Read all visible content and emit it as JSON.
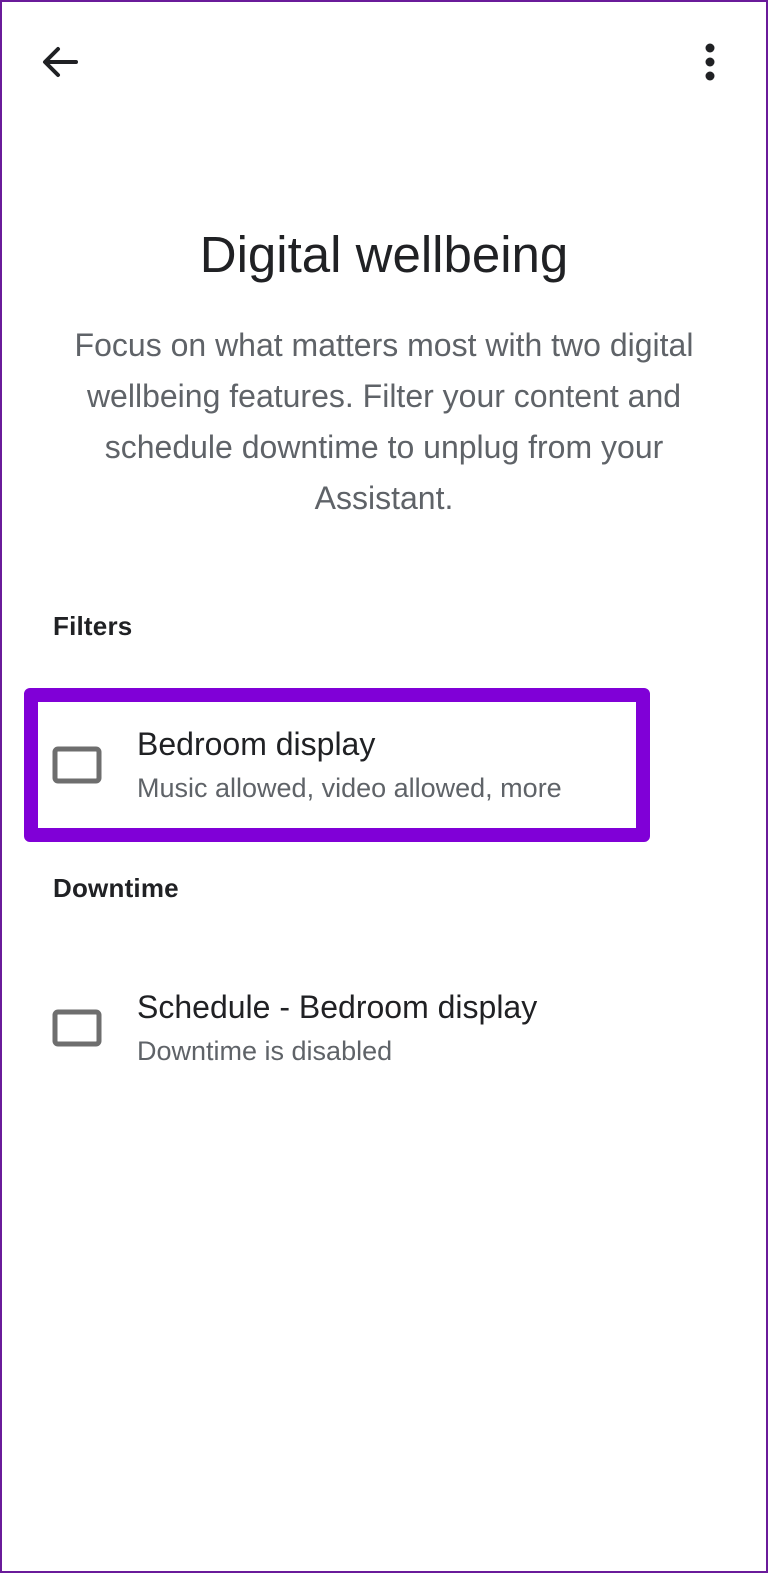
{
  "header": {
    "back_icon": "arrow-back-icon",
    "menu_icon": "more-vert-icon"
  },
  "page": {
    "title": "Digital wellbeing",
    "description": "Focus on what matters most with two digital wellbeing features. Filter your content and schedule downtime to unplug from your Assistant."
  },
  "sections": {
    "filters": {
      "header": "Filters",
      "item": {
        "icon": "display-device-icon",
        "title": "Bedroom display",
        "subtitle": "Music allowed, video allowed, more"
      }
    },
    "downtime": {
      "header": "Downtime",
      "item": {
        "icon": "display-device-icon",
        "title": "Schedule - Bedroom display",
        "subtitle": "Downtime is disabled"
      }
    }
  },
  "colors": {
    "highlight": "#8000d7",
    "primary_text": "#202124",
    "secondary_text": "#5f6368",
    "icon": "#6e6e6e"
  }
}
